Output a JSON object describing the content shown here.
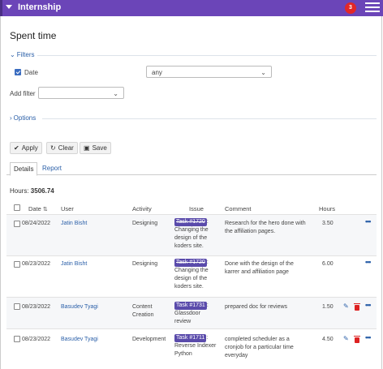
{
  "topbar": {
    "project": "Internship",
    "notification_count": "3"
  },
  "page": {
    "title": "Spent time"
  },
  "filters": {
    "legend": "Filters",
    "date_label": "Date",
    "date_operator": "any",
    "add_filter_label": "Add filter",
    "add_filter_value": ""
  },
  "options": {
    "legend": "Options"
  },
  "actions": {
    "apply": "Apply",
    "clear": "Clear",
    "save": "Save"
  },
  "tabs": {
    "details": "Details",
    "report": "Report"
  },
  "summary": {
    "label": "Hours:",
    "total": "3506.74"
  },
  "table": {
    "headers": {
      "date": "Date",
      "user": "User",
      "activity": "Activity",
      "issue": "Issue",
      "comment": "Comment",
      "hours": "Hours"
    },
    "rows": [
      {
        "date": "08/24/2022",
        "user": "Jatin Bisht",
        "activity": "Designing",
        "task": "Task #1720",
        "task_closed": true,
        "issue_colon": ":",
        "issue_l1": "Changing the",
        "issue_l2": "design of the",
        "issue_l3": "koders site.",
        "comment_l1": "Research for the hero done with",
        "comment_l2": "the affiliation pages.",
        "comment_l3": "",
        "hours": "3.50"
      },
      {
        "date": "08/23/2022",
        "user": "Jatin Bisht",
        "activity": "Designing",
        "task": "Task #1720",
        "task_closed": true,
        "issue_colon": ":",
        "issue_l1": "Changing the",
        "issue_l2": "design of the",
        "issue_l3": "koders site.",
        "comment_l1": "Done with the design of the",
        "comment_l2": "karrer and affiliation page",
        "comment_l3": "",
        "hours": "6.00"
      },
      {
        "date": "08/23/2022",
        "user": "Basudev Tyagi",
        "activity_l1": "Content",
        "activity_l2": "Creation",
        "task": "Task #1731",
        "task_closed": false,
        "issue_colon": ":",
        "issue_l1": "Glassdoor",
        "issue_l2": "review",
        "issue_l3": "",
        "comment_l1": "prepared doc for reviews",
        "comment_l2": "",
        "comment_l3": "",
        "hours": "1.50"
      },
      {
        "date": "08/23/2022",
        "user": "Basudev Tyagi",
        "activity": "Development",
        "task": "Task #1711",
        "task_closed": false,
        "issue_colon": ":",
        "issue_l1": "Reverse Indexer",
        "issue_l2": "Python",
        "issue_l3": "",
        "comment_l1": "completed scheduler as a",
        "comment_l2": "cronjob for a particular time",
        "comment_l3": "everyday",
        "hours": "4.50"
      }
    ]
  }
}
